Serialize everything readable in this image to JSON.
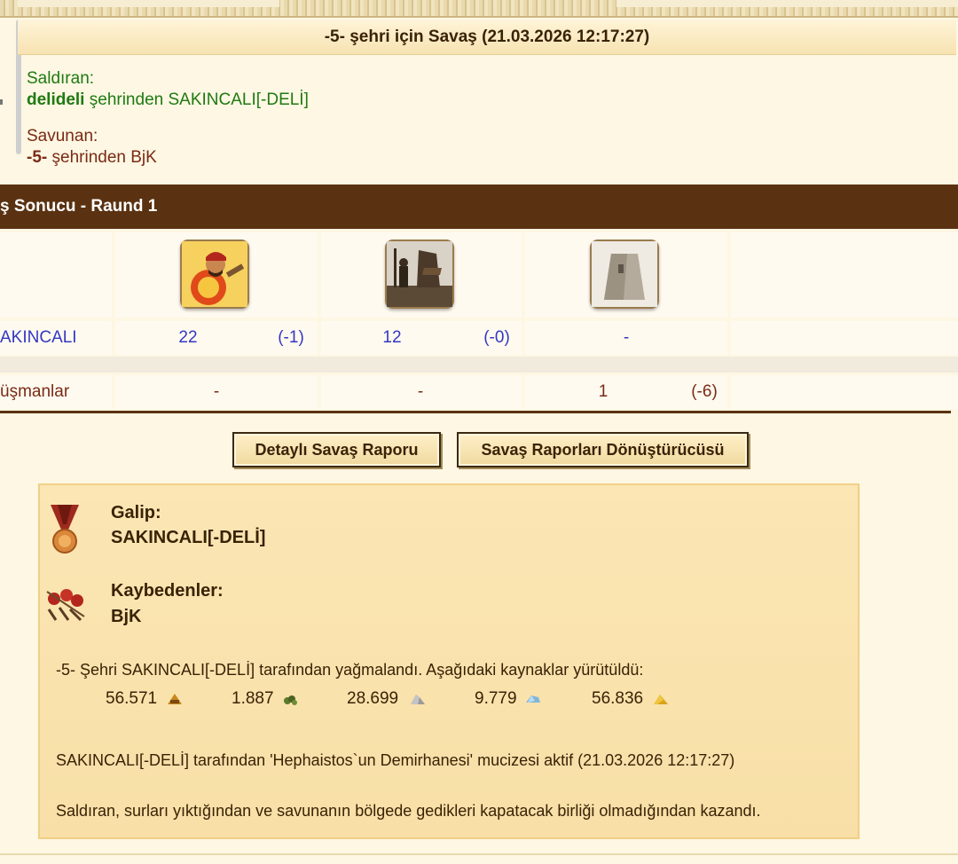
{
  "header": {
    "title": "-5- şehri için Savaş (21.03.2026 12:17:27)"
  },
  "attacker": {
    "label": "Saldıran:",
    "city": "delideli",
    "text": "şehrinden SAKINCALI[-DELİ]"
  },
  "defender": {
    "label": "Savunan:",
    "city": "-5-",
    "text": "şehrinden BjK"
  },
  "round": {
    "title": "ş Sonucu - Raund 1"
  },
  "units": [
    {
      "icon": "hoplite-unit-icon"
    },
    {
      "icon": "catapult-unit-icon"
    },
    {
      "icon": "city-wall-icon"
    }
  ],
  "rows": [
    {
      "label": "AKINCALI",
      "cells": [
        [
          "22",
          "(-1)"
        ],
        [
          "12",
          "(-0)"
        ],
        [
          "-",
          ""
        ]
      ]
    },
    {
      "label": "üşmanlar",
      "cells": [
        [
          "-",
          ""
        ],
        [
          "-",
          ""
        ],
        [
          "1",
          "(-6)"
        ]
      ]
    }
  ],
  "buttons": {
    "detailed": "Detaylı Savaş Raporu",
    "converter": "Savaş Raporları Dönüştürücüsü"
  },
  "result": {
    "winner_label": "Galip:",
    "winner": "SAKINCALI[-DELİ]",
    "losers_label": "Kaybedenler:",
    "losers": "BjK",
    "plunder_text": "-5- Şehri SAKINCALI[-DELİ] tarafından yağmalandı. Aşağıdaki kaynaklar yürütüldü:",
    "resources": [
      {
        "value": "56.571",
        "icon": "wood-icon",
        "color": "#c8881e"
      },
      {
        "value": "1.887",
        "icon": "wine-icon",
        "color": "#5d7a2a"
      },
      {
        "value": "28.699",
        "icon": "marble-icon",
        "color": "#9b9b9b"
      },
      {
        "value": "9.779",
        "icon": "crystal-icon",
        "color": "#7fb6d8"
      },
      {
        "value": "56.836",
        "icon": "sulfur-icon",
        "color": "#d9a21a"
      }
    ],
    "miracle_text": "SAKINCALI[-DELİ] tarafından 'Hephaistos`un Demirhanesi' mucizesi aktif (21.03.2026 12:17:27)",
    "reason_text": "Saldıran, surları yıktığından ve savunanın bölgede gedikleri kapatacak birliği olmadığından kazandı."
  }
}
